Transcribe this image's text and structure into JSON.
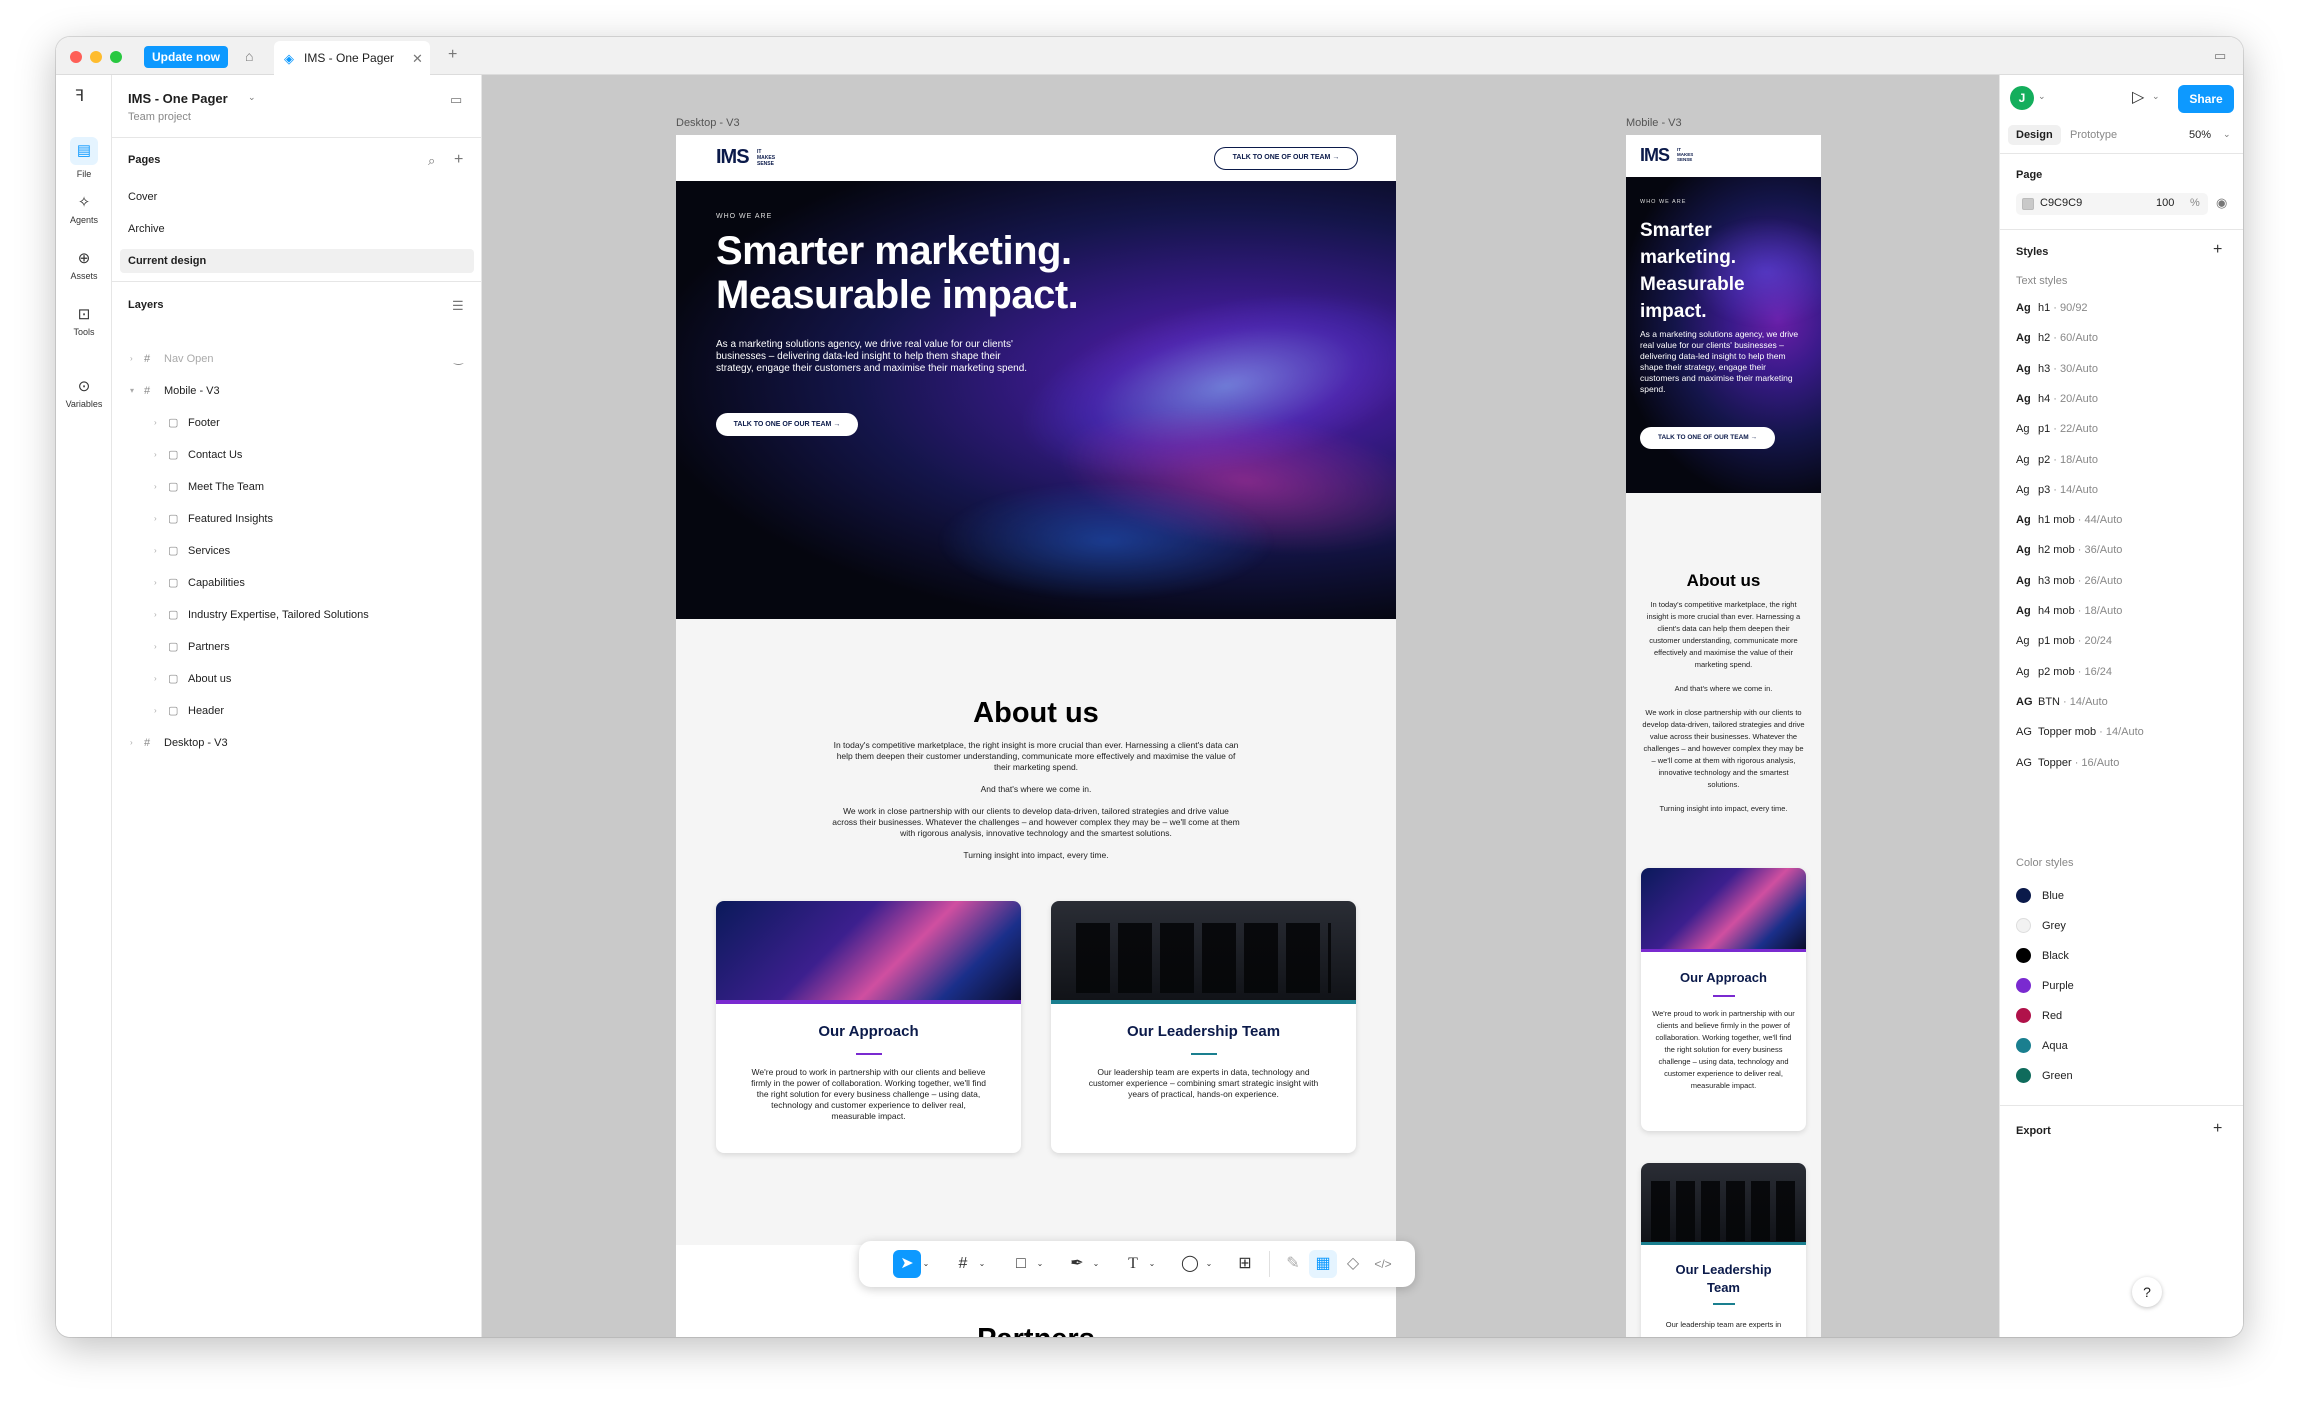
{
  "titlebar": {
    "update_label": "Update now",
    "tab_title": "IMS - One Pager",
    "add_tab": "+"
  },
  "rail": {
    "items": [
      {
        "label": "File",
        "icon": "file-icon"
      },
      {
        "label": "Agents",
        "icon": "agents-icon"
      },
      {
        "label": "Assets",
        "icon": "assets-icon"
      },
      {
        "label": "Tools",
        "icon": "tools-icon"
      },
      {
        "label": "Variables",
        "icon": "variables-icon"
      }
    ]
  },
  "left_panel": {
    "file_title": "IMS - One Pager",
    "file_sub": "Team project",
    "pages_heading": "Pages",
    "pages": [
      "Cover",
      "Archive",
      "Current design"
    ],
    "layers_heading": "Layers",
    "layers": [
      {
        "label": "Nav Open",
        "depth": 0,
        "dim": true
      },
      {
        "label": "Mobile - V3",
        "depth": 0,
        "open": true
      },
      {
        "label": "Footer",
        "depth": 1
      },
      {
        "label": "Contact Us",
        "depth": 1
      },
      {
        "label": "Meet The Team",
        "depth": 1
      },
      {
        "label": "Featured Insights",
        "depth": 1
      },
      {
        "label": "Services",
        "depth": 1
      },
      {
        "label": "Capabilities",
        "depth": 1
      },
      {
        "label": "Industry Expertise,  Tailored Solutions",
        "depth": 1
      },
      {
        "label": "Partners",
        "depth": 1
      },
      {
        "label": "About us",
        "depth": 1
      },
      {
        "label": "Header",
        "depth": 1
      },
      {
        "label": "Desktop - V3",
        "depth": 0
      }
    ]
  },
  "canvas": {
    "desktop_label": "Desktop - V3",
    "mobile_label": "Mobile - V3",
    "logo": "IMS",
    "logo_tag": "IT MAKES SENSE",
    "nav_cta": "TALK TO ONE OF OUR TEAM →",
    "eyebrow": "WHO WE ARE",
    "hero_line1": "Smarter marketing.",
    "hero_line2": "Measurable impact.",
    "hero_body": "As a marketing solutions agency, we drive real value for our clients' businesses – delivering data-led insight to help them shape their strategy, engage their customers and maximise their marketing spend.",
    "hero_cta": "TALK TO ONE OF OUR TEAM →",
    "mobile_hero": "Smarter marketing. Measurable impact.",
    "about_title": "About us",
    "about_p1": "In today's competitive marketplace, the right insight is more crucial than ever. Harnessing a client's data can help them deepen their customer understanding, communicate more effectively and maximise the value of their marketing spend.",
    "about_p2": "And that's where we come in.",
    "about_p3": "We work in close partnership with our clients to develop data-driven, tailored strategies and drive value across their businesses. Whatever the challenges – and however complex they may be – we'll come at them with rigorous analysis, innovative technology and the smartest solutions.",
    "about_p4": "Turning insight into impact, every time.",
    "card1_title": "Our Approach",
    "card1_body": "We're proud to work in partnership with our clients and believe firmly in the power of collaboration. Working together, we'll find the right solution for every business challenge – using data, technology and customer experience to deliver real, measurable impact.",
    "card2_title": "Our Leadership Team",
    "card2_body": "Our leadership team are experts in data, technology and customer experience – combining smart strategic insight with years of practical, hands-on experience.",
    "mobile_card2_body": "Our leadership team are experts in",
    "next_title": "Partners"
  },
  "right_panel": {
    "avatar": "J",
    "share": "Share",
    "tab_design": "Design",
    "tab_prototype": "Prototype",
    "zoom": "50%",
    "page_heading": "Page",
    "page_color": "C9C9C9",
    "page_opacity": "100",
    "page_pct": "%",
    "styles_heading": "Styles",
    "text_styles_heading": "Text styles",
    "text_styles": [
      {
        "ag": "Ag",
        "name": "h1",
        "meta": " · 90/92",
        "bold": true
      },
      {
        "ag": "Ag",
        "name": "h2",
        "meta": " · 60/Auto",
        "bold": true
      },
      {
        "ag": "Ag",
        "name": "h3",
        "meta": " · 30/Auto",
        "bold": true
      },
      {
        "ag": "Ag",
        "name": "h4",
        "meta": " · 20/Auto",
        "bold": true
      },
      {
        "ag": "Ag",
        "name": "p1",
        "meta": " · 22/Auto",
        "bold": false
      },
      {
        "ag": "Ag",
        "name": "p2",
        "meta": " · 18/Auto",
        "bold": false
      },
      {
        "ag": "Ag",
        "name": "p3",
        "meta": " · 14/Auto",
        "bold": false
      },
      {
        "ag": "Ag",
        "name": "h1 mob",
        "meta": " · 44/Auto",
        "bold": true
      },
      {
        "ag": "Ag",
        "name": "h2 mob",
        "meta": " · 36/Auto",
        "bold": true
      },
      {
        "ag": "Ag",
        "name": "h3 mob",
        "meta": " · 26/Auto",
        "bold": true
      },
      {
        "ag": "Ag",
        "name": "h4 mob",
        "meta": " · 18/Auto",
        "bold": true
      },
      {
        "ag": "Ag",
        "name": "p1 mob",
        "meta": " · 20/24",
        "bold": false
      },
      {
        "ag": "Ag",
        "name": "p2 mob",
        "meta": " · 16/24",
        "bold": false
      },
      {
        "ag": "AG",
        "name": "BTN",
        "meta": " · 14/Auto",
        "bold": true
      },
      {
        "ag": "AG",
        "name": "Topper mob",
        "meta": " · 14/Auto",
        "bold": false
      },
      {
        "ag": "AG",
        "name": "Topper",
        "meta": " · 16/Auto",
        "bold": false
      }
    ],
    "color_styles_heading": "Color styles",
    "color_styles": [
      {
        "name": "Blue",
        "hex": "#0b1a4a"
      },
      {
        "name": "Grey",
        "hex": "#f2f2f2"
      },
      {
        "name": "Black",
        "hex": "#000000"
      },
      {
        "name": "Purple",
        "hex": "#7a2ad0"
      },
      {
        "name": "Red",
        "hex": "#b0124a"
      },
      {
        "name": "Aqua",
        "hex": "#1a7f8f"
      },
      {
        "name": "Green",
        "hex": "#0f6b5c"
      }
    ],
    "export_heading": "Export"
  },
  "help": "?"
}
